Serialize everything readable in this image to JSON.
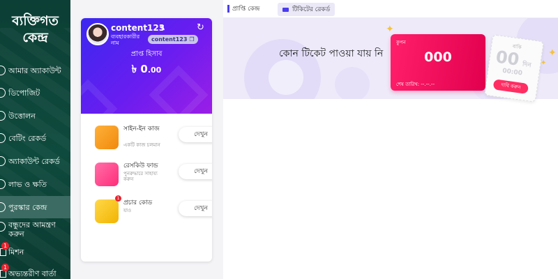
{
  "sidebar": {
    "title": "ব্যক্তিগত কেন্দ্র",
    "items": [
      {
        "label": "আমার অ্যাকাউন্ট"
      },
      {
        "label": "ডিপোজিট"
      },
      {
        "label": "উত্তোলন"
      },
      {
        "label": "বেটিং রেকর্ড"
      },
      {
        "label": "অ্যাকাউন্ট রেকর্ড"
      },
      {
        "label": "লাভ ও ক্ষতি"
      },
      {
        "label": "পুরস্কার কেন্দ্র",
        "active": true
      },
      {
        "label": "বন্ধুদের আমন্ত্রণ করুন"
      },
      {
        "label": "মিশন",
        "badge": "1"
      },
      {
        "label": "অভ্যন্তরীণ বার্তা",
        "badge": "1"
      }
    ]
  },
  "profile": {
    "username": "content123",
    "user_label": "ব্যবহারকারীর নাম",
    "user_chip": "content123",
    "account_title": "প্রাপ্ত হিসাব",
    "currency": "৳",
    "balance_int": "0",
    "balance_dec": ".00"
  },
  "features": [
    {
      "name": "সাইন-ইন কাজ",
      "sub": "একটি কাজ চলমান",
      "button": "দেখুন",
      "color": "#f5a623"
    },
    {
      "name": "রেসকিউ ফান্ড",
      "sub": "পুনরুদ্ধারে সাহায্য করুন",
      "button": "দেখুন",
      "color": "#ff4f8b"
    },
    {
      "name": "প্রচার কোড",
      "sub": "যাও",
      "button": "দেখুন",
      "color": "#f7c52b",
      "badge": "1"
    }
  ],
  "tabs": {
    "rewards_center": "প্রাপ্তি কেন্দ্র",
    "ticket_record": "টিকিটের রেকর্ড"
  },
  "content": {
    "no_ticket": "কোন টিকেট পাওয়া যায় নি",
    "coupon_title": "কুপন",
    "coupon_value": "000",
    "coupon_expiry": "শেষ তারিখ: --.--.--",
    "remaining_label": "বাকি",
    "remaining_days": "00",
    "days_unit": "দিন",
    "remaining_time": "00:00",
    "claim_button": "দাবি করুন"
  },
  "colors": {
    "sidebar_bg": "#0e4a3d",
    "sidebar_active": "#3b6b62",
    "profile_gradient_start": "#3a28f0",
    "profile_gradient_end": "#9b1ee6",
    "coupon_red": "#e2004e",
    "accent_blue": "#4b3cf0"
  }
}
